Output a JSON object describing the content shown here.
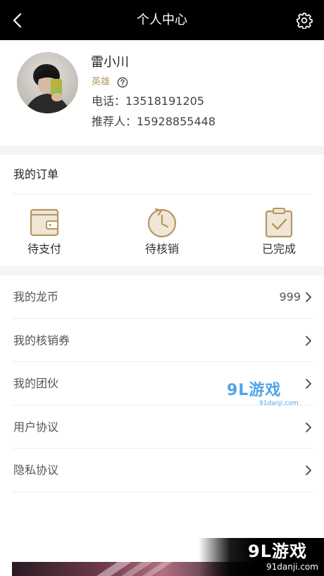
{
  "header": {
    "title": "个人中心",
    "back_icon": "chevron-left-icon",
    "settings_icon": "gear-icon"
  },
  "profile": {
    "name": "雷小川",
    "level": "英雄",
    "help_icon": "question-circle-icon",
    "phone": "电话：13518191205",
    "referrer": "推荐人：15928855448"
  },
  "orders": {
    "title": "我的订单",
    "items": [
      {
        "label": "待支付",
        "icon": "wallet-icon"
      },
      {
        "label": "待核销",
        "icon": "clock-icon"
      },
      {
        "label": "已完成",
        "icon": "clipboard-check-icon"
      }
    ]
  },
  "menu": {
    "items": [
      {
        "label": "我的龙币",
        "value": "999"
      },
      {
        "label": "我的核销券",
        "value": ""
      },
      {
        "label": "我的团伙",
        "value": ""
      },
      {
        "label": "用户协议",
        "value": ""
      },
      {
        "label": "隐私协议",
        "value": ""
      }
    ]
  },
  "watermarks": {
    "logo_text": "9L游戏",
    "url_text": "91danji.com"
  },
  "colors": {
    "accent": "#b89660",
    "header_bg": "#000000",
    "separator": "#f4f4f4"
  }
}
